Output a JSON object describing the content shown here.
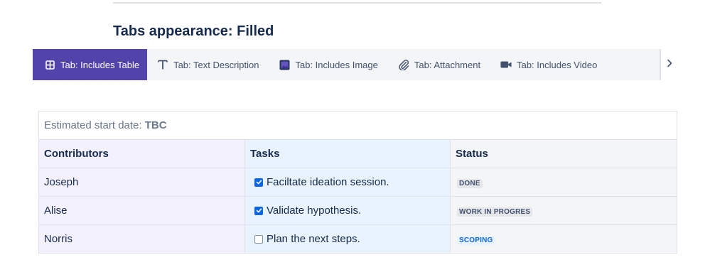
{
  "heading": "Tabs appearance: Filled",
  "tabs": [
    {
      "label": "Tab: Includes Table",
      "icon": "table-icon",
      "active": true
    },
    {
      "label": "Tab: Text Description",
      "icon": "text-icon",
      "active": false
    },
    {
      "label": "Tab: Includes Image",
      "icon": "image-icon",
      "active": false
    },
    {
      "label": "Tab: Attachment",
      "icon": "paperclip-icon",
      "active": false
    },
    {
      "label": "Tab: Includes Video",
      "icon": "video-icon",
      "active": false
    }
  ],
  "tab_scroll_icon": "chevron-right-icon",
  "table": {
    "caption_prefix": "Estimated start date: ",
    "caption_value": "TBC",
    "headers": [
      "Contributors",
      "Tasks",
      "Status"
    ],
    "rows": [
      {
        "contributor": "Joseph",
        "task": "Faciltate ideation session.",
        "checked": true,
        "status": "DONE",
        "status_style": "default"
      },
      {
        "contributor": "Alise",
        "task": "Validate hypothesis.",
        "checked": true,
        "status": "WORK IN PROGRES",
        "status_style": "default"
      },
      {
        "contributor": "Norris",
        "task": "Plan the next steps.",
        "checked": false,
        "status": "SCOPING",
        "status_style": "blue"
      }
    ]
  },
  "colors": {
    "active_tab": "#5243aa",
    "checkbox": "#0c66e4",
    "contributors_col": "#f3f0ff",
    "tasks_col": "#e9f2ff",
    "status_col": "#f4f5f7"
  }
}
